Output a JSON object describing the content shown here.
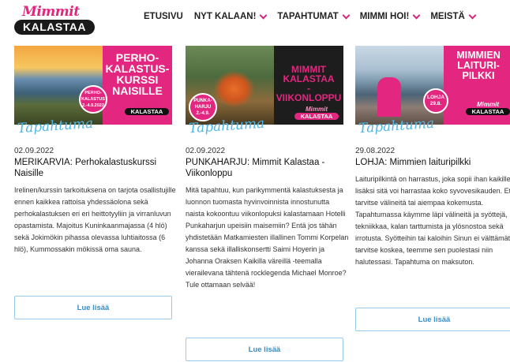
{
  "logo": {
    "top": "Mimmit",
    "bottom": "KALASTAA"
  },
  "nav": [
    {
      "label": "ETUSIVU",
      "dropdown": false
    },
    {
      "label": "NYT KALAAN!",
      "dropdown": true
    },
    {
      "label": "TAPAHTUMAT",
      "dropdown": true
    },
    {
      "label": "MIMMI HOI!",
      "dropdown": true
    },
    {
      "label": "MEISTÄ",
      "dropdown": true
    }
  ],
  "colors": {
    "brand_pink": "#e3267f",
    "link_blue": "#3a8dc8",
    "category_blue": "#4fb6e8"
  },
  "cards": [
    {
      "banner_title": "PERHO-\nKALASTUS-\nKURSSI\nNAISILLE",
      "badge": "PERHO-\nKALASTUS\n2.-4.9.2022",
      "category": "Tapahtuma",
      "date": "02.09.2022",
      "title": "MERIKARVIA: Perhokalastuskurssi Naisille",
      "body": "Irelinen/kurssin tarkoituksena on tarjota osallistujille ennen kaikkea rattoisa yhdessäolona sekä perhokalastuksen eri eri heittotyyliin ja virranluvun opastamista. Majoitus Kuninkaanmajassa (4 hlö) sekä Jokimökin pihassa olevassa luhtiaitossa (6 hlö), Kummossakin mökissä oma sauna.",
      "button": "Lue lisää"
    },
    {
      "banner_title": "MIMMIT\nKALASTAA\n-VIIKONLOPPU",
      "badge": "PUNKA-\nHARJU\n2.-4.9.",
      "category": "Tapahtuma",
      "date": "02.09.2022",
      "title": "PUNKAHARJU: Mimmit Kalastaa -Viikonloppu",
      "body": "Mitä tapahtuu, kun parikymmentä kalastuksesta ja luonnon tuomasta hyvinvoinnista innostunutta naista kokoontuu viikonlopuksi kalastamaan Hotelli Punkaharjun upeisiin maisemiin? Entä jos tähän yhdistetään Matkamiesten illallinen Tommi Korpelan kanssa sekä illalliskonsertti Saimi Hoyerin ja Johanna Oraksen Kaikilla väreillä -teemalla vierailevana tähtenä rocklegenda Michael Monroe? Tule ottamaan selvää!",
      "button": "Lue lisää"
    },
    {
      "banner_title": "MIMMIEN\nLAITURI-\nPILKKI",
      "badge": "LOHJA\n29.8.",
      "category": "Tapahtuma",
      "date": "29.08.2022",
      "title": "LOHJA: Mimmien laituripilkki",
      "body": "Laituripilkintä on harrastus, joka sopii ihan kaikille ja lisäksi sitä voi harrastaa koko syvovesikauden. Et tarvitse välineitä tai aiempaa kokemusta. Tapahtumassa käymme läpi välineitä ja syöttejä, tekniikkaa, kalan tarttumista ja ylösnostoa sekä irrotusta. Syötteihin tai kaloihin Sinun ei välttämättä tarvitse koskea, teemme sen puolestasi niin halutessasi. Tapahtuma on maksuton.",
      "button": "Lue lisää"
    }
  ]
}
